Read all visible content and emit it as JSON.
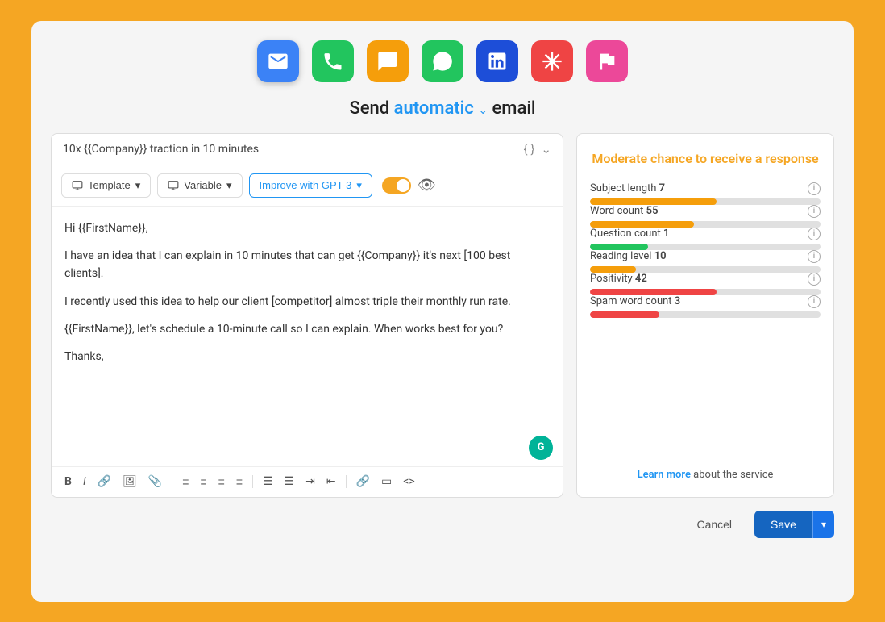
{
  "outer": {
    "title": "Send",
    "title_auto": "automatic",
    "title_suffix": "email",
    "chevron": "⌄"
  },
  "channels": [
    {
      "id": "email",
      "label": "Email",
      "color": "#3B82F6",
      "active": true,
      "icon": "email"
    },
    {
      "id": "phone",
      "label": "Phone",
      "color": "#22C55E",
      "active": false,
      "icon": "phone"
    },
    {
      "id": "chat",
      "label": "Chat",
      "color": "#F59E0B",
      "active": false,
      "icon": "chat"
    },
    {
      "id": "whatsapp",
      "label": "WhatsApp",
      "color": "#22C55E",
      "active": false,
      "icon": "whatsapp"
    },
    {
      "id": "linkedin",
      "label": "LinkedIn",
      "color": "#1D4ED8",
      "active": false,
      "icon": "linkedin"
    },
    {
      "id": "asterisk",
      "label": "Asterisk",
      "color": "#EF4444",
      "active": false,
      "icon": "asterisk"
    },
    {
      "id": "flag",
      "label": "Flag",
      "color": "#EC4899",
      "active": false,
      "icon": "flag"
    }
  ],
  "editor": {
    "subject": "10x {{Company}} traction in 10 minutes",
    "subject_icons": "{ }",
    "template_label": "Template",
    "variable_label": "Variable",
    "gpt_label": "Improve with GPT-3",
    "body_lines": [
      "Hi {{FirstName}},",
      "",
      "I have an idea that I can explain in 10 minutes that can get {{Company}} it's next [100 best clients].",
      "",
      "I recently used this idea to help our client [competitor] almost triple their monthly run rate.",
      "",
      "{{FirstName}}, let's schedule a 10-minute call so I can explain. When works best for you?",
      "",
      "Thanks,"
    ]
  },
  "stats": {
    "title": "Moderate chance to receive a response",
    "metrics": [
      {
        "label": "Subject length",
        "value": "7",
        "color": "#F59E0B",
        "fill_pct": 55
      },
      {
        "label": "Word count",
        "value": "55",
        "color": "#F59E0B",
        "fill_pct": 45
      },
      {
        "label": "Question count",
        "value": "1",
        "color": "#22C55E",
        "fill_pct": 25
      },
      {
        "label": "Reading level",
        "value": "10",
        "color": "#F59E0B",
        "fill_pct": 20
      },
      {
        "label": "Positivity",
        "value": "42",
        "color": "#EF4444",
        "fill_pct": 55
      },
      {
        "label": "Spam word count",
        "value": "3",
        "color": "#EF4444",
        "fill_pct": 30
      }
    ],
    "learn_more_link": "Learn more",
    "learn_more_text": " about the service"
  },
  "footer": {
    "cancel_label": "Cancel",
    "save_label": "Save"
  },
  "format_bar": {
    "icons": [
      "B",
      "I",
      "🔗",
      "🖼",
      "📎",
      "≡",
      "≡",
      "≡",
      "≡",
      "≡",
      "≡",
      "⇥",
      "⇤",
      "🔗",
      "▭",
      "<>"
    ]
  }
}
